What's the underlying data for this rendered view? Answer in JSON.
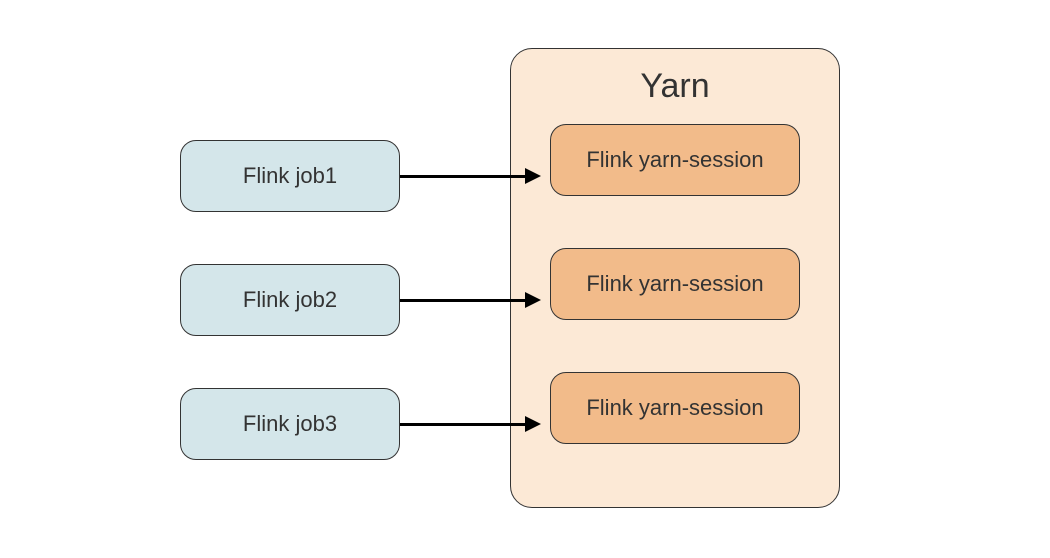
{
  "jobs": {
    "job1": "Flink job1",
    "job2": "Flink job2",
    "job3": "Flink job3"
  },
  "yarn": {
    "title": "Yarn",
    "sessions": {
      "session1": "Flink yarn-session",
      "session2": "Flink yarn-session",
      "session3": "Flink yarn-session"
    }
  }
}
